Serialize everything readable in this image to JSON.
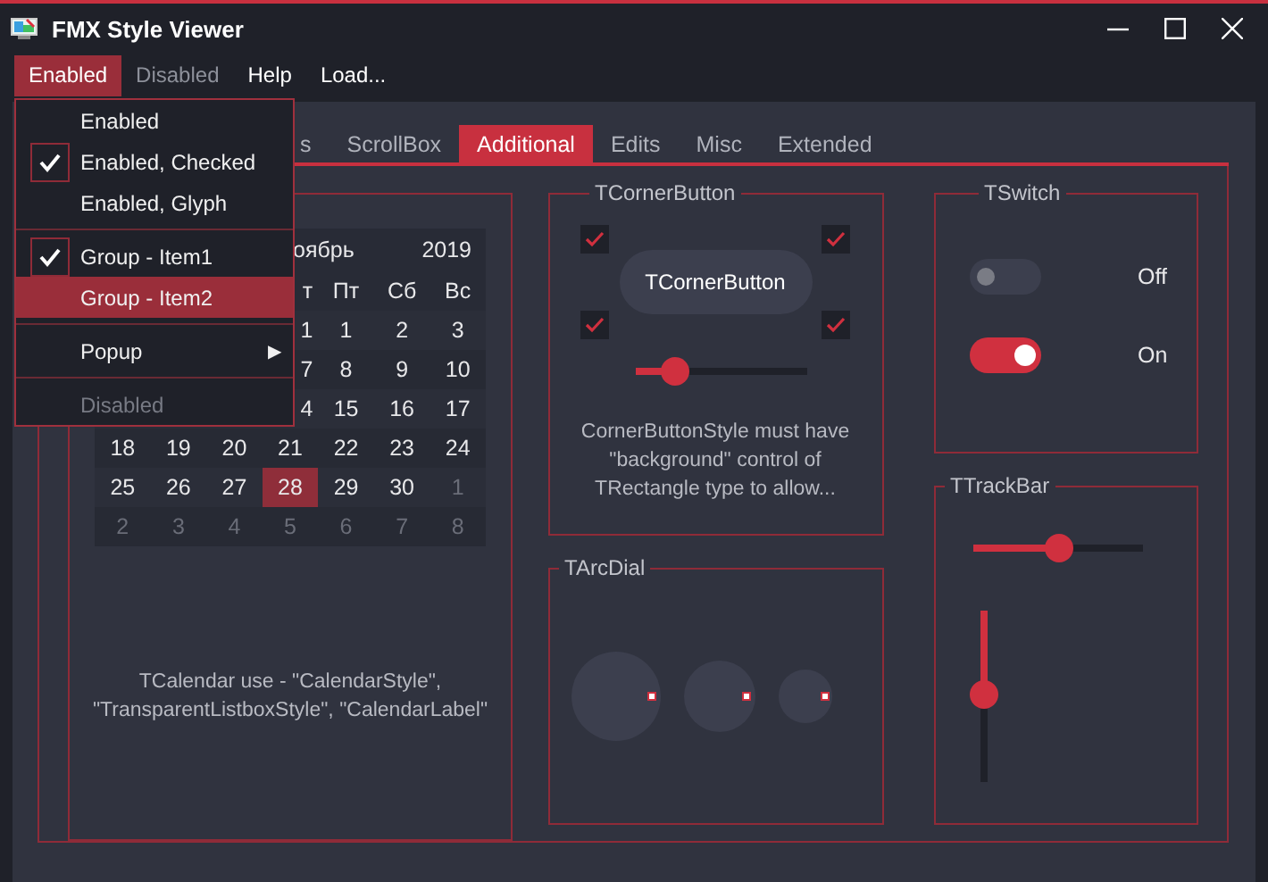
{
  "window": {
    "title": "FMX Style Viewer"
  },
  "menubar": [
    {
      "label": "Enabled",
      "selected": true,
      "disabled": false
    },
    {
      "label": "Disabled",
      "selected": false,
      "disabled": true
    },
    {
      "label": "Help",
      "selected": false,
      "disabled": false
    },
    {
      "label": "Load...",
      "selected": false,
      "disabled": false
    }
  ],
  "menu": [
    {
      "kind": "item",
      "label": "Enabled",
      "checked": false,
      "disabled": false,
      "selected": false
    },
    {
      "kind": "item",
      "label": "Enabled, Checked",
      "checked": true,
      "disabled": false,
      "selected": false
    },
    {
      "kind": "item",
      "label": "Enabled, Glyph",
      "checked": false,
      "disabled": false,
      "selected": false
    },
    {
      "kind": "separator"
    },
    {
      "kind": "item",
      "label": "Group - Item1",
      "checked": true,
      "disabled": false,
      "selected": false
    },
    {
      "kind": "item",
      "label": "Group - Item2",
      "checked": false,
      "disabled": false,
      "selected": true
    },
    {
      "kind": "separator"
    },
    {
      "kind": "submenu",
      "label": "Popup",
      "arrow": "▶",
      "checked": false,
      "disabled": false,
      "selected": false
    },
    {
      "kind": "separator"
    },
    {
      "kind": "item",
      "label": "Disabled",
      "checked": false,
      "disabled": true,
      "selected": false
    }
  ],
  "tabs": [
    {
      "label": "s",
      "selected": false
    },
    {
      "label": "ScrollBox",
      "selected": false
    },
    {
      "label": "Additional",
      "selected": true
    },
    {
      "label": "Edits",
      "selected": false
    },
    {
      "label": "Misc",
      "selected": false
    },
    {
      "label": "Extended",
      "selected": false
    }
  ],
  "calendar": {
    "month": "оябрь",
    "year": "2019",
    "weekdays": [
      "т",
      "Пт",
      "Сб",
      "Вс"
    ],
    "weeks": [
      {
        "days": [
          {
            "label": "1",
            "other_month": false,
            "selected": false
          },
          {
            "label": "1",
            "other_month": false,
            "selected": false
          },
          {
            "label": "2",
            "other_month": false,
            "selected": false
          },
          {
            "label": "3",
            "other_month": false,
            "selected": false
          }
        ]
      },
      {
        "days": [
          {
            "label": "7",
            "other_month": false,
            "selected": false
          },
          {
            "label": "8",
            "other_month": false,
            "selected": false
          },
          {
            "label": "9",
            "other_month": false,
            "selected": false
          },
          {
            "label": "10",
            "other_month": false,
            "selected": false
          }
        ]
      },
      {
        "days": [
          {
            "label": "4",
            "other_month": false,
            "selected": false
          },
          {
            "label": "15",
            "other_month": false,
            "selected": false
          },
          {
            "label": "16",
            "other_month": false,
            "selected": false
          },
          {
            "label": "17",
            "other_month": false,
            "selected": false
          }
        ]
      },
      {
        "days": [
          {
            "label": "18",
            "other_month": false,
            "selected": false
          },
          {
            "label": "19",
            "other_month": false,
            "selected": false
          },
          {
            "label": "20",
            "other_month": false,
            "selected": false
          },
          {
            "label": "21",
            "other_month": false,
            "selected": false
          },
          {
            "label": "22",
            "other_month": false,
            "selected": false
          },
          {
            "label": "23",
            "other_month": false,
            "selected": false
          },
          {
            "label": "24",
            "other_month": false,
            "selected": false
          }
        ]
      },
      {
        "days": [
          {
            "label": "25",
            "other_month": false,
            "selected": false
          },
          {
            "label": "26",
            "other_month": false,
            "selected": false
          },
          {
            "label": "27",
            "other_month": false,
            "selected": false
          },
          {
            "label": "28",
            "other_month": false,
            "selected": true
          },
          {
            "label": "29",
            "other_month": false,
            "selected": false
          },
          {
            "label": "30",
            "other_month": false,
            "selected": false
          },
          {
            "label": "1",
            "other_month": true,
            "selected": false
          }
        ]
      },
      {
        "days": [
          {
            "label": "2",
            "other_month": true,
            "selected": false
          },
          {
            "label": "3",
            "other_month": true,
            "selected": false
          },
          {
            "label": "4",
            "other_month": true,
            "selected": false
          },
          {
            "label": "5",
            "other_month": true,
            "selected": false
          },
          {
            "label": "6",
            "other_month": true,
            "selected": false
          },
          {
            "label": "7",
            "other_month": true,
            "selected": false
          },
          {
            "label": "8",
            "other_month": true,
            "selected": false
          }
        ]
      }
    ],
    "caption": "TCalendar use - \"CalendarStyle\", \"TransparentListboxStyle\", \"CalendarLabel\""
  },
  "corner_button": {
    "title": "TCornerButton",
    "button": "TCornerButton",
    "checkboxes": [
      {
        "checked": true
      },
      {
        "checked": true
      },
      {
        "checked": true
      },
      {
        "checked": true
      }
    ],
    "slider": {
      "level": 0.23
    },
    "note": "CornerButtonStyle must have \"background\" control of TRectangle type to allow..."
  },
  "arc_dial": {
    "title": "TArcDial"
  },
  "switch": {
    "title": "TSwitch",
    "switches": [
      {
        "on": false,
        "label": "Off"
      },
      {
        "on": true,
        "label": "On"
      }
    ]
  },
  "trackbar": {
    "title": "TTrackBar",
    "horizontal": {
      "level": 0.5
    },
    "vertical": {
      "level": 0.49
    }
  }
}
